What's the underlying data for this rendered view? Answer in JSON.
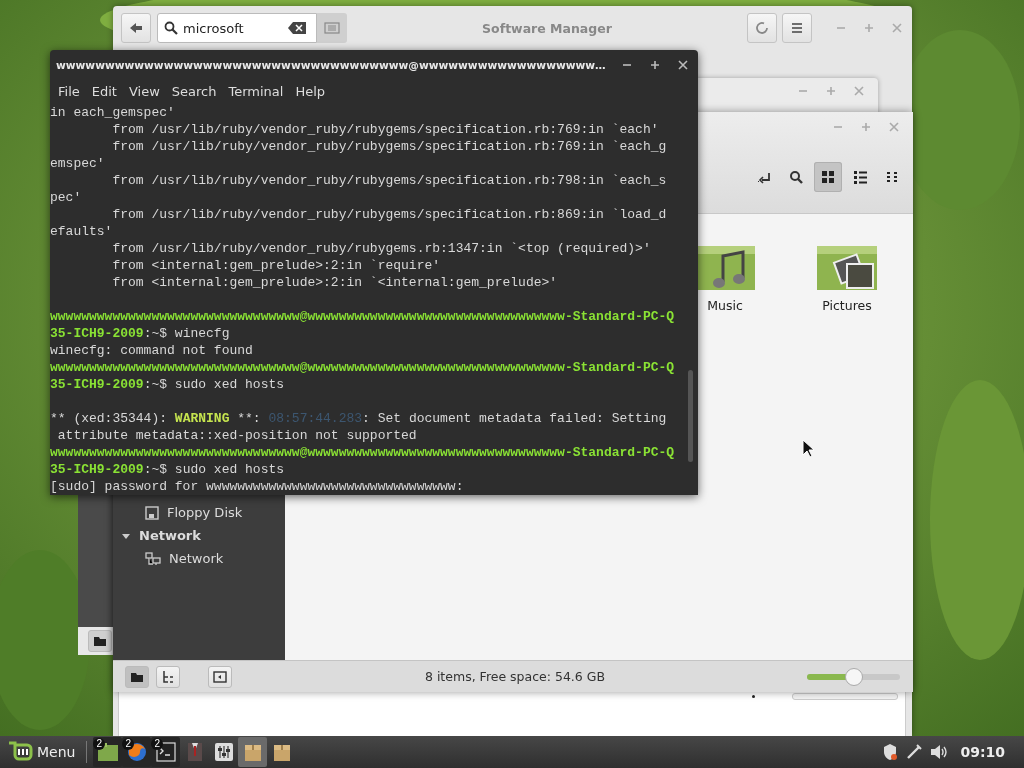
{
  "software_manager": {
    "title": "Software Manager",
    "search": {
      "value": "microsoft"
    }
  },
  "file_manager": {
    "toolbar": [
      {
        "kind": "path",
        "selected": false
      },
      {
        "kind": "search",
        "selected": false
      },
      {
        "kind": "grid",
        "selected": true
      },
      {
        "kind": "list",
        "selected": false
      },
      {
        "kind": "compact",
        "selected": false
      }
    ],
    "sidebar": {
      "items": [
        {
          "kind": "floppy",
          "label": "Floppy Disk"
        }
      ],
      "sections": [
        {
          "label": "Network",
          "expanded": true,
          "children": [
            {
              "kind": "network",
              "label": "Network"
            }
          ]
        }
      ]
    },
    "files": [
      {
        "kind": "music",
        "label": "Music"
      },
      {
        "kind": "pictures",
        "label": "Pictures"
      }
    ],
    "status_buttons": [
      {
        "kind": "places",
        "selected": true
      },
      {
        "kind": "tree",
        "selected": false
      },
      {
        "kind": "sidebar",
        "selected": false
      }
    ],
    "status": "8 items, Free space: 54.6 GB",
    "zoom": {
      "level": 0.5
    }
  },
  "terminal": {
    "title": "wwwwwwwwwwwwwwwwwwwwwwwwwwwwwwwwwwww@wwwwwwwwwwwwwwwwww…",
    "menu": [
      "File",
      "Edit",
      "View",
      "Search",
      "Terminal",
      "Help"
    ],
    "lines": [
      {
        "kind": "text",
        "segments": [
          {
            "kind": "plain",
            "text": "in each_gemspec'"
          }
        ]
      },
      {
        "kind": "text",
        "segments": [
          {
            "kind": "plain",
            "text": "        from /usr/lib/ruby/vendor_ruby/rubygems/specification.rb:769:in `each'"
          }
        ]
      },
      {
        "kind": "text",
        "segments": [
          {
            "kind": "plain",
            "text": "        from /usr/lib/ruby/vendor_ruby/rubygems/specification.rb:769:in `each_g"
          }
        ]
      },
      {
        "kind": "text",
        "segments": [
          {
            "kind": "plain",
            "text": "emspec'"
          }
        ]
      },
      {
        "kind": "text",
        "segments": [
          {
            "kind": "plain",
            "text": "        from /usr/lib/ruby/vendor_ruby/rubygems/specification.rb:798:in `each_s"
          }
        ]
      },
      {
        "kind": "text",
        "segments": [
          {
            "kind": "plain",
            "text": "pec'"
          }
        ]
      },
      {
        "kind": "text",
        "segments": [
          {
            "kind": "plain",
            "text": "        from /usr/lib/ruby/vendor_ruby/rubygems/specification.rb:869:in `load_d"
          }
        ]
      },
      {
        "kind": "text",
        "segments": [
          {
            "kind": "plain",
            "text": "efaults'"
          }
        ]
      },
      {
        "kind": "text",
        "segments": [
          {
            "kind": "plain",
            "text": "        from /usr/lib/ruby/vendor_ruby/rubygems.rb:1347:in `<top (required)>'"
          }
        ]
      },
      {
        "kind": "text",
        "segments": [
          {
            "kind": "plain",
            "text": "        from <internal:gem_prelude>:2:in `require'"
          }
        ]
      },
      {
        "kind": "text",
        "segments": [
          {
            "kind": "plain",
            "text": "        from <internal:gem_prelude>:2:in `<internal:gem_prelude>'"
          }
        ]
      },
      {
        "kind": "blank"
      },
      {
        "kind": "text",
        "segments": [
          {
            "kind": "prompt",
            "text": "wwwwwwwwwwwwwwwwwwwwwwwwwwwwwwww@wwwwwwwwwwwwwwwwwwwwwwwwwwwwwwwww-Standard-PC-Q"
          }
        ]
      },
      {
        "kind": "text",
        "segments": [
          {
            "kind": "prompt",
            "text": "35-ICH9-2009"
          },
          {
            "kind": "plain",
            "text": ":~$ winecfg"
          }
        ]
      },
      {
        "kind": "text",
        "segments": [
          {
            "kind": "plain",
            "text": "winecfg: command not found"
          }
        ]
      },
      {
        "kind": "text",
        "segments": [
          {
            "kind": "prompt",
            "text": "wwwwwwwwwwwwwwwwwwwwwwwwwwwwwwww@wwwwwwwwwwwwwwwwwwwwwwwwwwwwwwwww-Standard-PC-Q"
          }
        ]
      },
      {
        "kind": "text",
        "segments": [
          {
            "kind": "prompt",
            "text": "35-ICH9-2009"
          },
          {
            "kind": "plain",
            "text": ":~$ sudo xed hosts"
          }
        ]
      },
      {
        "kind": "blank"
      },
      {
        "kind": "text",
        "segments": [
          {
            "kind": "plain",
            "text": "** (xed:35344): "
          },
          {
            "kind": "warning",
            "text": "WARNING"
          },
          {
            "kind": "plain",
            "text": " **: "
          },
          {
            "kind": "dim",
            "text": "08:57:44.283"
          },
          {
            "kind": "plain",
            "text": ": Set document metadata failed: Setting"
          }
        ]
      },
      {
        "kind": "text",
        "segments": [
          {
            "kind": "plain",
            "text": " attribute metadata::xed-position not supported"
          }
        ]
      },
      {
        "kind": "text",
        "segments": [
          {
            "kind": "prompt",
            "text": "wwwwwwwwwwwwwwwwwwwwwwwwwwwwwwww@wwwwwwwwwwwwwwwwwwwwwwwwwwwwwwwww-Standard-PC-Q"
          }
        ]
      },
      {
        "kind": "text",
        "segments": [
          {
            "kind": "prompt",
            "text": "35-ICH9-2009"
          },
          {
            "kind": "plain",
            "text": ":~$ sudo xed hosts"
          }
        ]
      },
      {
        "kind": "text",
        "segments": [
          {
            "kind": "plain",
            "text": "[sudo] password for wwwwwwwwwwwwwwwwwwwwwwwwwwwwwwww:"
          }
        ]
      }
    ]
  },
  "taskbar": {
    "menu": "Menu",
    "launchers": [
      {
        "kind": "files",
        "badge": "2",
        "selected": false
      },
      {
        "kind": "browser",
        "badge": "2",
        "selected": false
      },
      {
        "kind": "terminal",
        "badge": "2",
        "selected": false
      },
      {
        "kind": "suit",
        "selected": false
      },
      {
        "kind": "mixer",
        "selected": false
      },
      {
        "kind": "package",
        "selected": true
      },
      {
        "kind": "package",
        "selected": false
      }
    ],
    "tray": [
      {
        "kind": "shield"
      },
      {
        "kind": "network"
      },
      {
        "kind": "volume"
      }
    ],
    "clock": "09:10"
  }
}
